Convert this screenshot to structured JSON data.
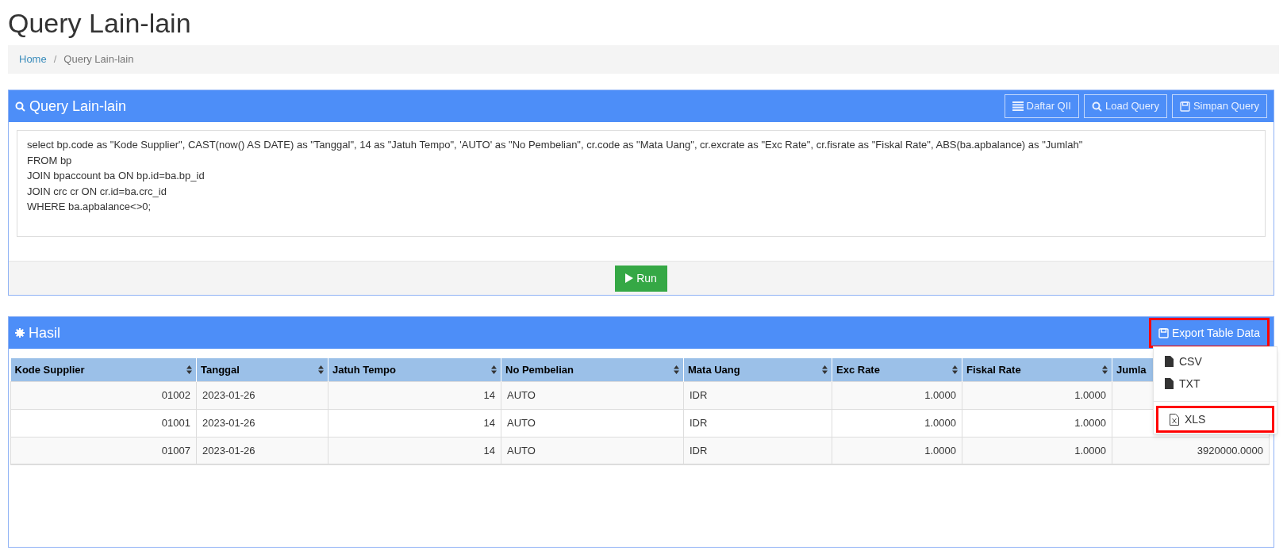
{
  "page_title": "Query Lain-lain",
  "breadcrumb": {
    "separator": "/",
    "items": [
      {
        "label": "Home",
        "link": true
      },
      {
        "label": "Query Lain-lain",
        "link": false
      }
    ]
  },
  "query_panel": {
    "title": "Query Lain-lain",
    "buttons": [
      {
        "label": "Daftar QII",
        "kind": "list"
      },
      {
        "label": "Load Query",
        "kind": "search"
      },
      {
        "label": "Simpan Query",
        "kind": "save"
      }
    ],
    "query_lines": [
      "select bp.code as \"Kode Supplier\", CAST(now() AS DATE) as \"Tanggal\", 14 as \"Jatuh Tempo\", 'AUTO' as \"No Pembelian\", cr.code as \"Mata Uang\", cr.excrate as \"Exc Rate\", cr.fisrate as \"Fiskal Rate\", ABS(ba.apbalance) as \"Jumlah\"",
      "FROM bp",
      "JOIN bpaccount ba ON bp.id=ba.bp_id",
      "JOIN crc cr ON cr.id=ba.crc_id",
      "WHERE ba.apbalance<>0;"
    ],
    "run_button": "Run"
  },
  "result_panel": {
    "title": "Hasil",
    "export_button": {
      "label": "Export Table Data",
      "highlighted": true
    },
    "export_menu": [
      {
        "label": "CSV",
        "kind": "file",
        "highlighted": false
      },
      {
        "label": "TXT",
        "kind": "file",
        "highlighted": false
      },
      {
        "label": "XLS",
        "kind": "excel",
        "highlighted": true
      }
    ],
    "table": {
      "columns": [
        {
          "label": "Kode Supplier",
          "kind": "number"
        },
        {
          "label": "Tanggal",
          "kind": "text"
        },
        {
          "label": "Jatuh Tempo",
          "kind": "number"
        },
        {
          "label": "No Pembelian",
          "kind": "text"
        },
        {
          "label": "Mata Uang",
          "kind": "text"
        },
        {
          "label": "Exc Rate",
          "kind": "number"
        },
        {
          "label": "Fiskal Rate",
          "kind": "number"
        },
        {
          "label": "Jumla",
          "kind": "number"
        }
      ],
      "rows": [
        [
          "01002",
          "2023-01-26",
          "14",
          "AUTO",
          "IDR",
          "1.0000",
          "1.0000"
        ],
        [
          "01001",
          "2023-01-26",
          "14",
          "AUTO",
          "IDR",
          "1.0000",
          "1.0000"
        ],
        [
          "01007",
          "2023-01-26",
          "14",
          "AUTO",
          "IDR",
          "1.0000",
          "1.0000",
          "3920000.0000"
        ]
      ]
    }
  }
}
